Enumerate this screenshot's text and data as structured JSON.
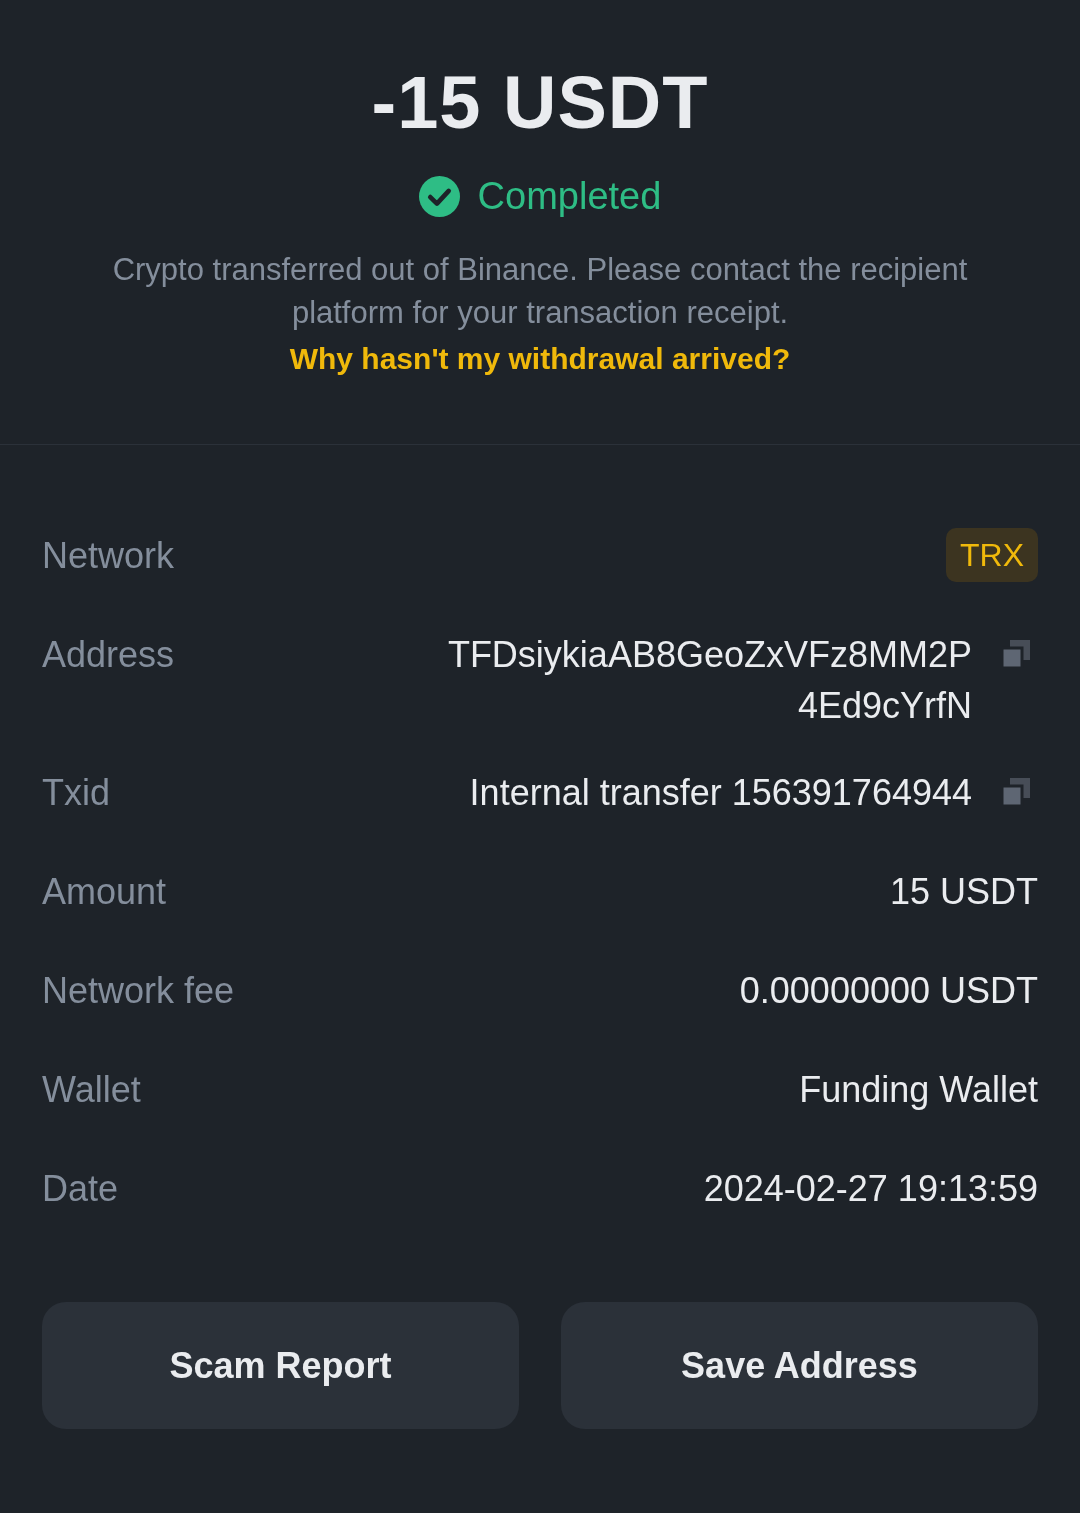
{
  "amount": "-15 USDT",
  "status": {
    "label": "Completed",
    "kind": "success"
  },
  "notice": "Crypto transferred out of Binance. Please contact the recipient platform for your transaction receipt.",
  "help_link": "Why hasn't my withdrawal arrived?",
  "details": [
    {
      "label": "Network",
      "kind": "badge",
      "value_lines": [
        "TRX"
      ]
    },
    {
      "label": "Address",
      "kind": "copy",
      "value_lines": [
        "TFDsiykiaAB8GeoZxVFz8MM2P",
        "4Ed9cYrfN"
      ]
    },
    {
      "label": "Txid",
      "kind": "copy",
      "value_lines": [
        "Internal transfer 156391764944"
      ]
    },
    {
      "label": "Amount",
      "kind": "text",
      "value_lines": [
        "15 USDT"
      ]
    },
    {
      "label": "Network fee",
      "kind": "text",
      "value_lines": [
        "0.00000000 USDT"
      ]
    },
    {
      "label": "Wallet",
      "kind": "text",
      "value_lines": [
        "Funding Wallet"
      ]
    },
    {
      "label": "Date",
      "kind": "text",
      "value_lines": [
        "2024-02-27 19:13:59"
      ]
    }
  ],
  "buttons": [
    {
      "label": "Scam Report"
    },
    {
      "label": "Save Address"
    }
  ]
}
